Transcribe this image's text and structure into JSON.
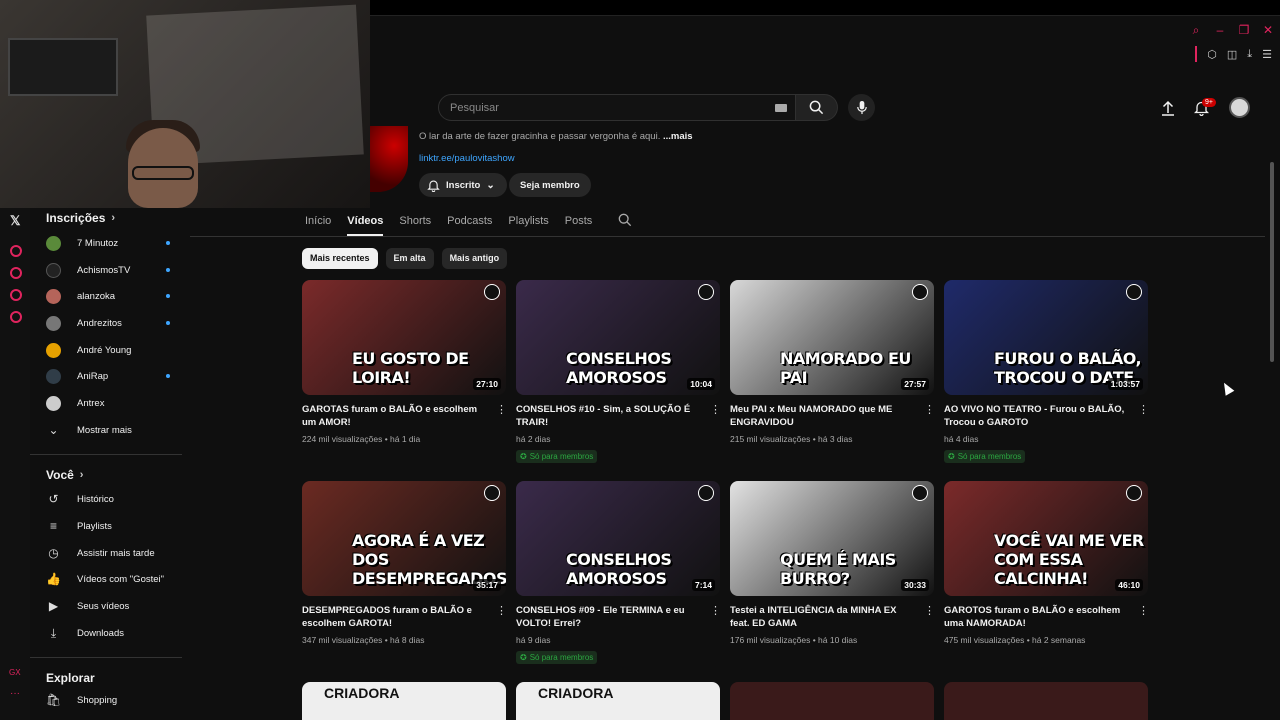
{
  "search": {
    "placeholder": "Pesquisar"
  },
  "header": {
    "notifications_badge": "9+"
  },
  "channel": {
    "description": "O lar da arte de fazer gracinha e passar vergonha é aqui. ",
    "description_more": "...mais",
    "link": "linktr.ee/paulovitashow",
    "subscribed_label": "Inscrito",
    "member_label": "Seja membro"
  },
  "tabs": [
    "Início",
    "Vídeos",
    "Shorts",
    "Podcasts",
    "Playlists",
    "Posts"
  ],
  "chips": [
    "Mais recentes",
    "Em alta",
    "Mais antigo"
  ],
  "sidebar": {
    "subs_title": "Inscrições",
    "subs": [
      {
        "label": "7 Minutoz",
        "color": "#5a8a3a"
      },
      {
        "label": "AchismosTV",
        "color": "#222222"
      },
      {
        "label": "alanzoka",
        "color": "#b5645a"
      },
      {
        "label": "Andrezitos",
        "color": "#777777"
      },
      {
        "label": "André Young",
        "color": "#e6a100"
      },
      {
        "label": "AniRap",
        "color": "#303d48"
      },
      {
        "label": "Antrex",
        "color": "#cccccc"
      }
    ],
    "show_more": "Mostrar mais",
    "you_title": "Você",
    "you_items": [
      {
        "label": "Histórico",
        "icon": "history-icon",
        "glyph": "↺"
      },
      {
        "label": "Playlists",
        "icon": "playlists-icon",
        "glyph": "≡"
      },
      {
        "label": "Assistir mais tarde",
        "icon": "clock-icon",
        "glyph": "◷"
      },
      {
        "label": "Vídeos com \"Gostei\"",
        "icon": "thumbs-up-icon",
        "glyph": "👍"
      },
      {
        "label": "Seus vídeos",
        "icon": "your-videos-icon",
        "glyph": "▶"
      },
      {
        "label": "Downloads",
        "icon": "download-icon",
        "glyph": "⤓"
      }
    ],
    "explore_title": "Explorar",
    "explore_items": [
      {
        "label": "Shopping",
        "icon": "shopping-bag-icon",
        "glyph": "🛍"
      }
    ]
  },
  "videos": [
    {
      "title": "GAROTAS furam o BALÃO e escolhem um AMOR!",
      "views": "224 mil visualizações",
      "age": "há 1 dia",
      "duration": "27:10",
      "thumb_text": "EU GOSTO DE LOIRA!",
      "bg": "#7b2a2a",
      "members": false
    },
    {
      "title": "CONSELHOS #10 - Sim, a SOLUÇÃO É TRAIR!",
      "views": "",
      "age": "há 2 dias",
      "duration": "10:04",
      "thumb_text": "CONSELHOS AMOROSOS",
      "bg": "#3a2a4a",
      "members": true
    },
    {
      "title": "Meu PAI x Meu NAMORADO que ME ENGRAVIDOU",
      "views": "215 mil visualizações",
      "age": "há 3 dias",
      "duration": "27:57",
      "thumb_text": "NAMORADO EU PAI",
      "bg": "#d8d8d8",
      "members": false
    },
    {
      "title": "AO VIVO NO TEATRO - Furou o BALÃO, Trocou o GAROTO",
      "views": "",
      "age": "há 4 dias",
      "duration": "1:03:57",
      "thumb_text": "FUROU O BALÃO, TROCOU O DATE",
      "bg": "#1f2a6a",
      "members": true
    },
    {
      "title": "DESEMPREGADOS furam o BALÃO e escolhem GAROTA!",
      "views": "347 mil visualizações",
      "age": "há 8 dias",
      "duration": "35:17",
      "thumb_text": "AGORA É A VEZ DOS DESEMPREGADOS",
      "bg": "#6b2a22",
      "members": false
    },
    {
      "title": "CONSELHOS #09 - Ele TERMINA e eu VOLTO! Errei?",
      "views": "",
      "age": "há 9 dias",
      "duration": "7:14",
      "thumb_text": "CONSELHOS AMOROSOS",
      "bg": "#3a2a4a",
      "members": true
    },
    {
      "title": "Testei a INTELIGÊNCIA da MINHA EX feat. ED GAMA",
      "views": "176 mil visualizações",
      "age": "há 10 dias",
      "duration": "30:33",
      "thumb_text": "QUEM É MAIS BURRO?",
      "bg": "#e2e2e2",
      "members": false
    },
    {
      "title": "GAROTOS furam o BALÃO e escolhem uma NAMORADA!",
      "views": "475 mil visualizações",
      "age": "há 2 semanas",
      "duration": "46:10",
      "thumb_text": "VOCÊ VAI ME VER COM ESSA CALCINHA!",
      "bg": "#7b2a2a",
      "members": false
    }
  ],
  "members_label": "Só para membros",
  "partial_row": [
    "CRIADORA",
    "CRIADORA",
    "",
    ""
  ]
}
